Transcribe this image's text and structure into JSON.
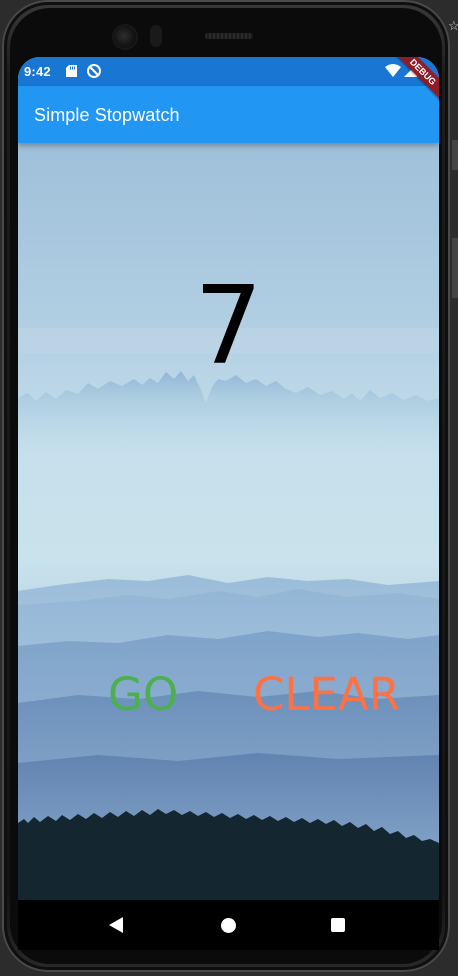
{
  "statusbar": {
    "time": "9:42",
    "icons": [
      "sd-card-icon",
      "do-not-disturb-icon",
      "wifi-icon",
      "signal-icon"
    ]
  },
  "appbar": {
    "title": "Simple Stopwatch",
    "debug_banner": "DEBUG"
  },
  "stopwatch": {
    "count": "7"
  },
  "controls": {
    "go_label": "GO",
    "clear_label": "CLEAR"
  },
  "colors": {
    "status_bar": "#1976d2",
    "app_bar": "#2196f3",
    "go": "#4caf50",
    "clear": "#ff7043",
    "debug": "#8c1d29"
  },
  "navbar": {
    "buttons": [
      "back-icon",
      "home-icon",
      "recents-icon"
    ]
  }
}
